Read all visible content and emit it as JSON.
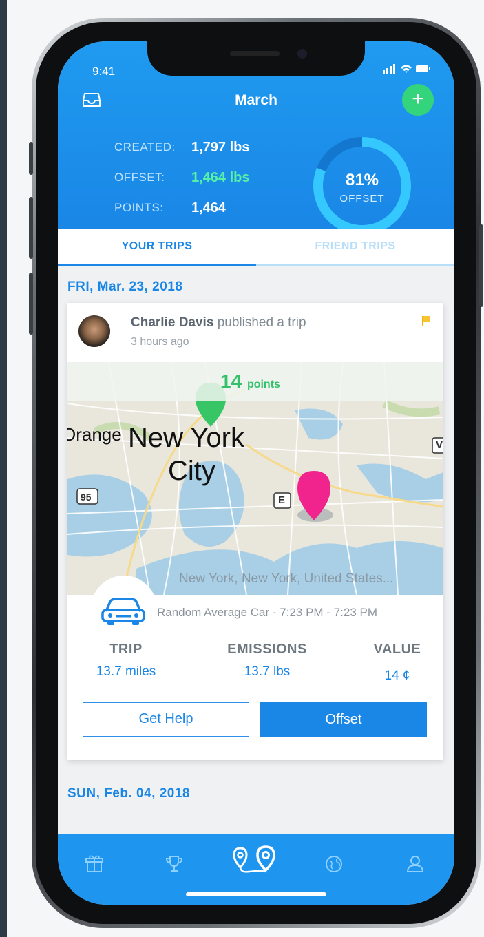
{
  "status_bar": {
    "time": "9:41"
  },
  "header": {
    "title": "March",
    "add_icon": "plus-icon",
    "inbox_icon": "inbox-icon",
    "stats": [
      {
        "label": "CREATED:",
        "value": "1,797 lbs",
        "color": "#ffffff"
      },
      {
        "label": "OFFSET:",
        "value": "1,464 lbs",
        "color": "#56f0a6"
      },
      {
        "label": "POINTS:",
        "value": "1,464",
        "color": "#ffffff"
      }
    ],
    "ring": {
      "percent_text": "81%",
      "label": "OFFSET",
      "fraction": 0.81
    }
  },
  "tabs": [
    {
      "label": "YOUR TRIPS",
      "active": true
    },
    {
      "label": "FRIEND TRIPS",
      "active": false
    }
  ],
  "sections": [
    {
      "date": "FRI, Mar. 23, 2018"
    },
    {
      "date": "SUN, Feb. 04, 2018"
    }
  ],
  "trip_card": {
    "user_name": "Charlie Davis",
    "action": "published a trip",
    "time_ago": "3 hours ago",
    "points_value": "14",
    "points_unit": "points",
    "map_labels": {
      "city_line1": "New York",
      "city_line2": "City",
      "left": "Orange",
      "highway": "95",
      "exit": "E",
      "right": "V"
    },
    "map_caption": "New York, New York, United States...",
    "vehicle_info": "Random Average Car - 7:23 PM - 7:23 PM",
    "metrics": [
      {
        "label": "TRIP",
        "value": "13.7 miles"
      },
      {
        "label": "EMISSIONS",
        "value": "13.7 lbs"
      },
      {
        "label": "VALUE",
        "value": "14 ¢"
      }
    ],
    "get_help_label": "Get Help",
    "offset_label": "Offset"
  },
  "bottom_nav": [
    {
      "icon": "gift-icon"
    },
    {
      "icon": "trophy-icon"
    },
    {
      "icon": "route-icon",
      "active": true
    },
    {
      "icon": "globe-icon"
    },
    {
      "icon": "profile-icon"
    }
  ],
  "colors": {
    "primary": "#1a86e6",
    "accent_green": "#33d47c",
    "pin_pink": "#f0248c"
  }
}
